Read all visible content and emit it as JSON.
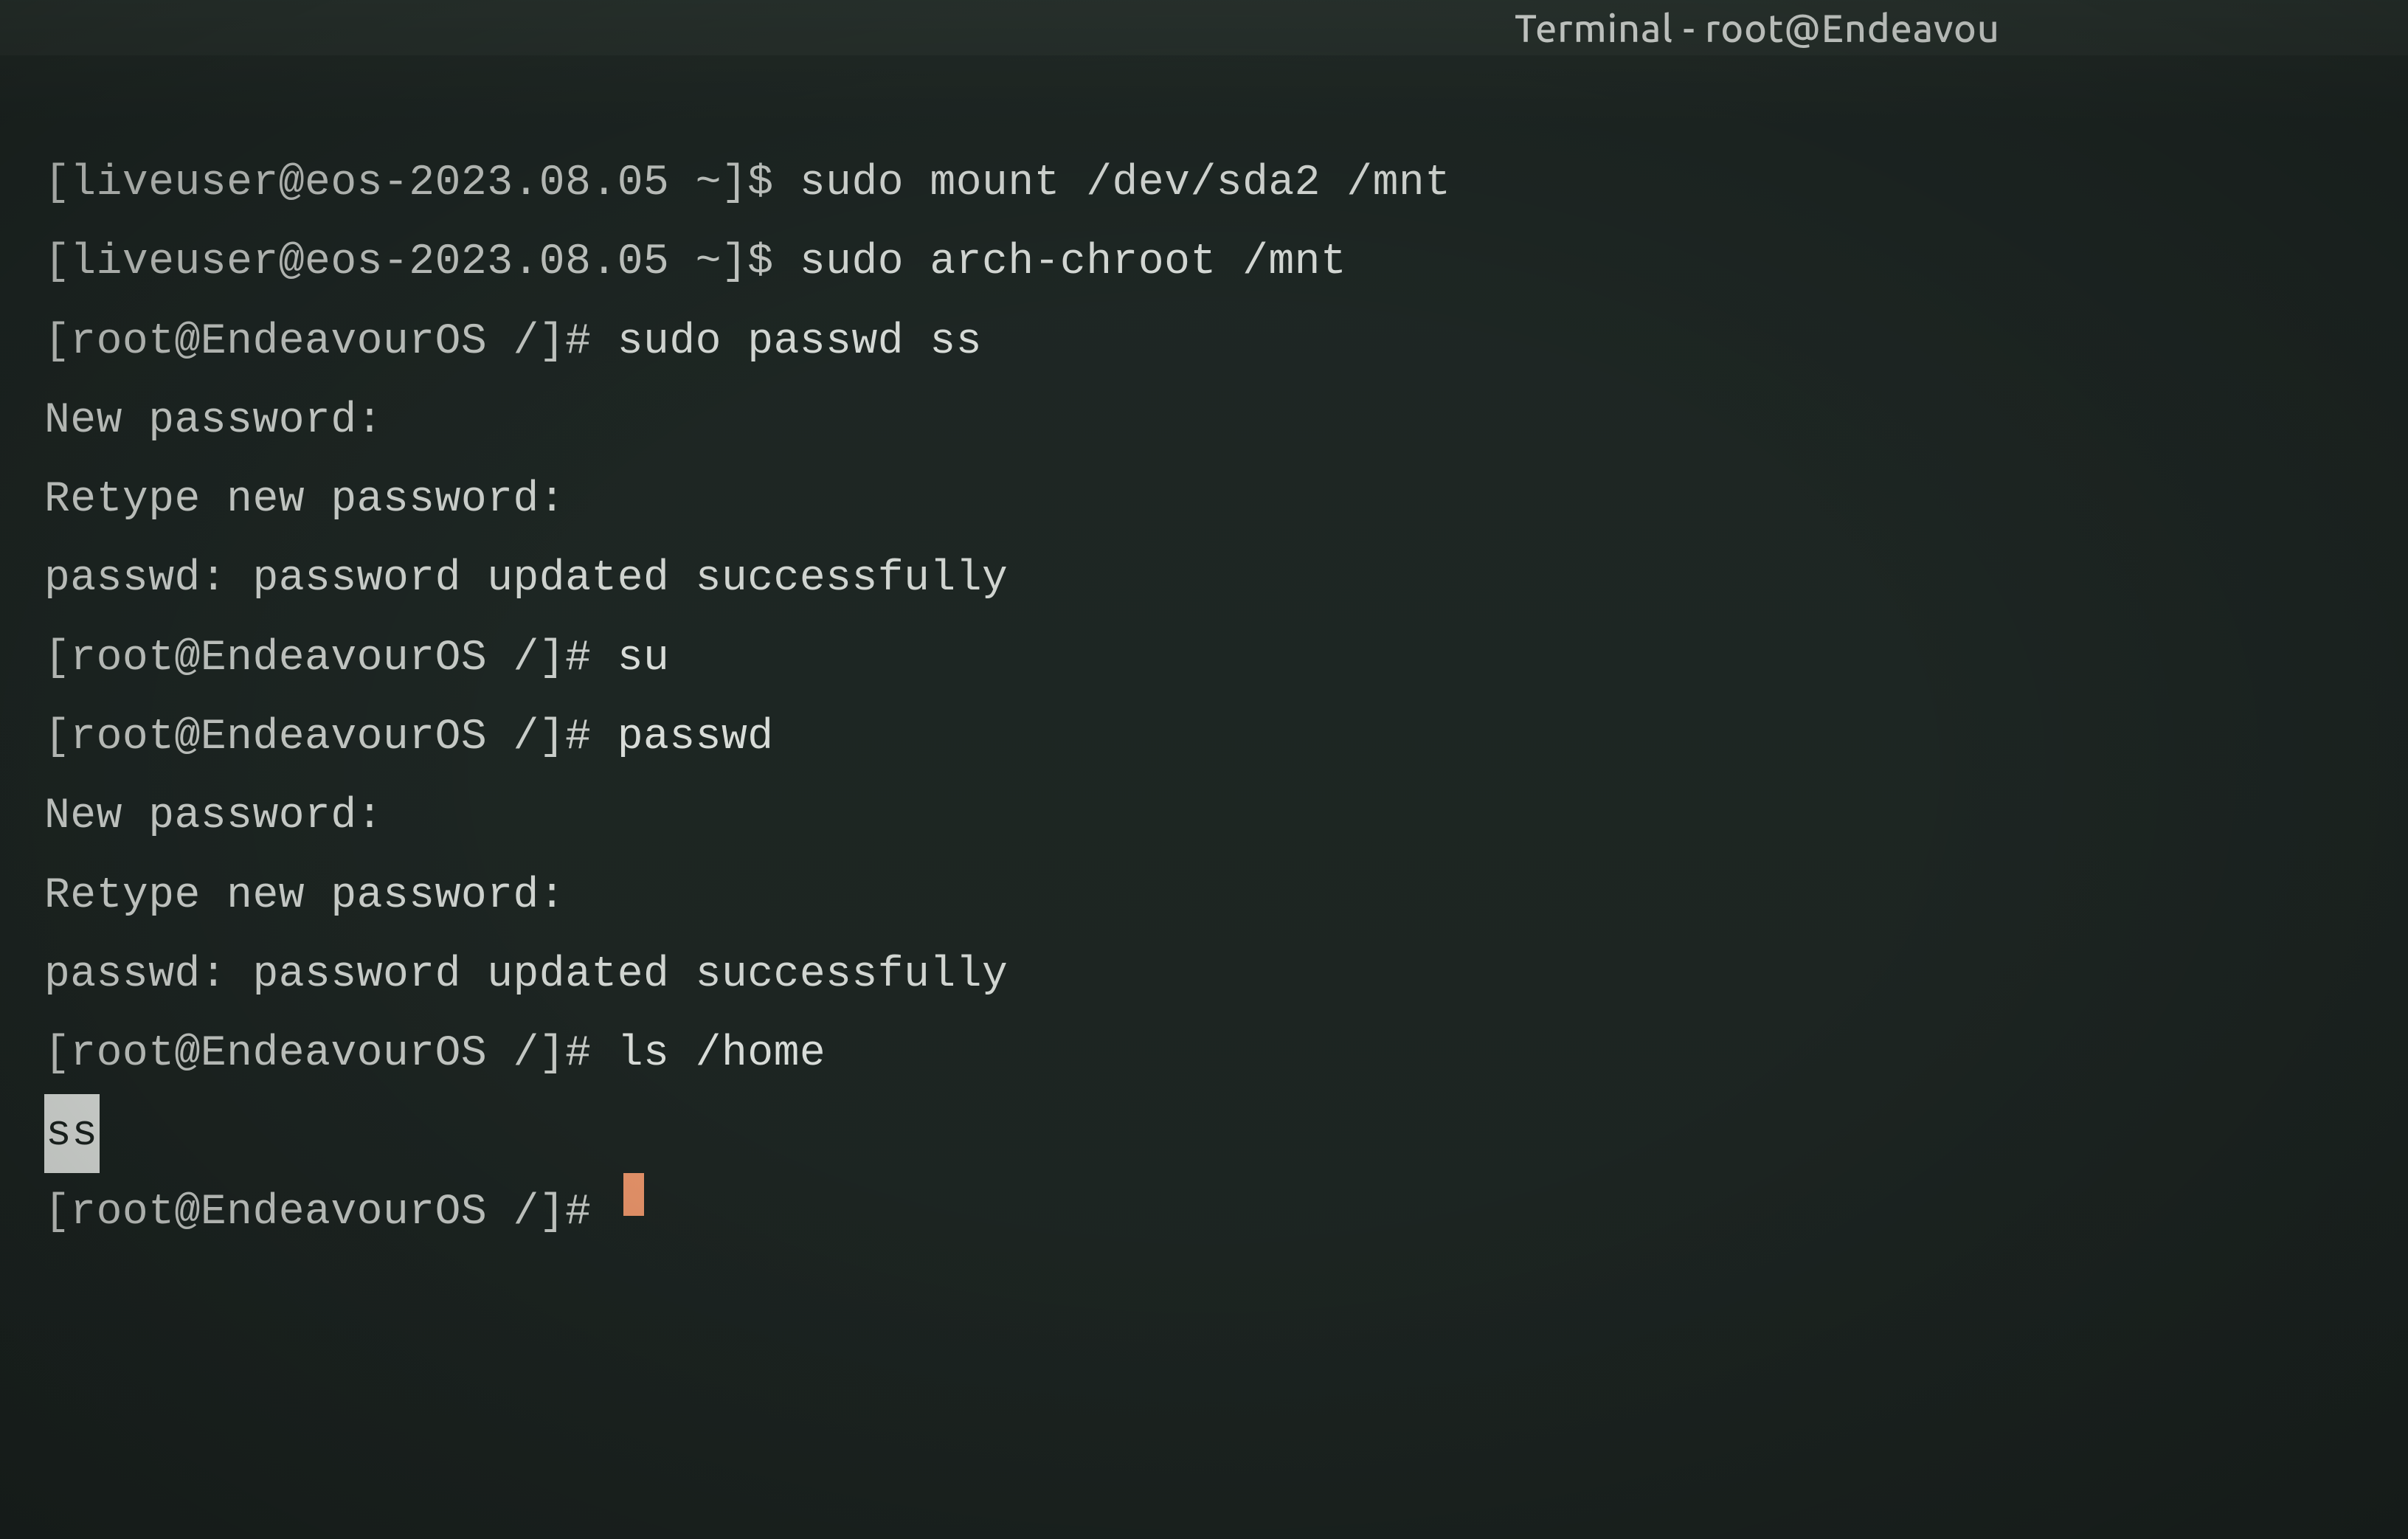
{
  "titlebar": {
    "text": "Terminal - root@Endeavou"
  },
  "lines": [
    {
      "prompt": "[liveuser@eos-2023.08.05 ~]$ ",
      "command": "sudo mount /dev/sda2 /mnt"
    },
    {
      "prompt": "[liveuser@eos-2023.08.05 ~]$ ",
      "command": "sudo arch-chroot /mnt"
    },
    {
      "prompt": "[root@EndeavourOS /]# ",
      "command": "sudo passwd ss"
    },
    {
      "output": "New password:"
    },
    {
      "output": "Retype new password:"
    },
    {
      "output": "passwd: password updated successfully"
    },
    {
      "prompt": "[root@EndeavourOS /]# ",
      "command": "su"
    },
    {
      "prompt": "[root@EndeavourOS /]# ",
      "command": "passwd"
    },
    {
      "output": "New password:"
    },
    {
      "output": "Retype new password:"
    },
    {
      "output": "passwd: password updated successfully"
    },
    {
      "prompt": "[root@EndeavourOS /]# ",
      "command": "ls /home"
    },
    {
      "highlighted": "ss"
    },
    {
      "prompt": "[root@EndeavourOS /]# ",
      "cursor": true
    }
  ]
}
